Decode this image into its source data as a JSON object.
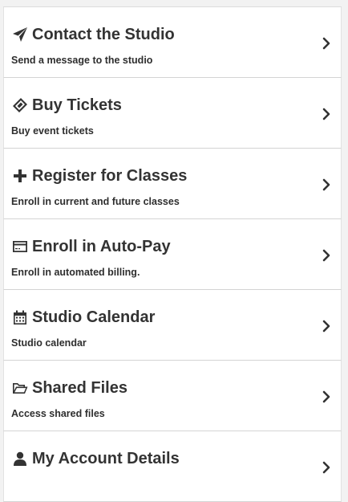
{
  "menu": {
    "items": [
      {
        "title": "Contact the Studio",
        "subtitle": "Send a message to the studio",
        "icon": "paper-plane-icon"
      },
      {
        "title": "Buy Tickets",
        "subtitle": "Buy event tickets",
        "icon": "ticket-icon"
      },
      {
        "title": "Register for Classes",
        "subtitle": "Enroll in current and future classes",
        "icon": "plus-icon"
      },
      {
        "title": "Enroll in Auto-Pay",
        "subtitle": "Enroll in automated billing.",
        "icon": "credit-card-icon"
      },
      {
        "title": "Studio Calendar",
        "subtitle": "Studio calendar",
        "icon": "calendar-icon"
      },
      {
        "title": "Shared Files",
        "subtitle": "Access shared files",
        "icon": "folder-open-icon"
      },
      {
        "title": "My Account Details",
        "subtitle": "",
        "icon": "user-icon"
      }
    ]
  },
  "colors": {
    "text": "#333333",
    "divider": "#d4d4d4",
    "background": "#ffffff"
  }
}
